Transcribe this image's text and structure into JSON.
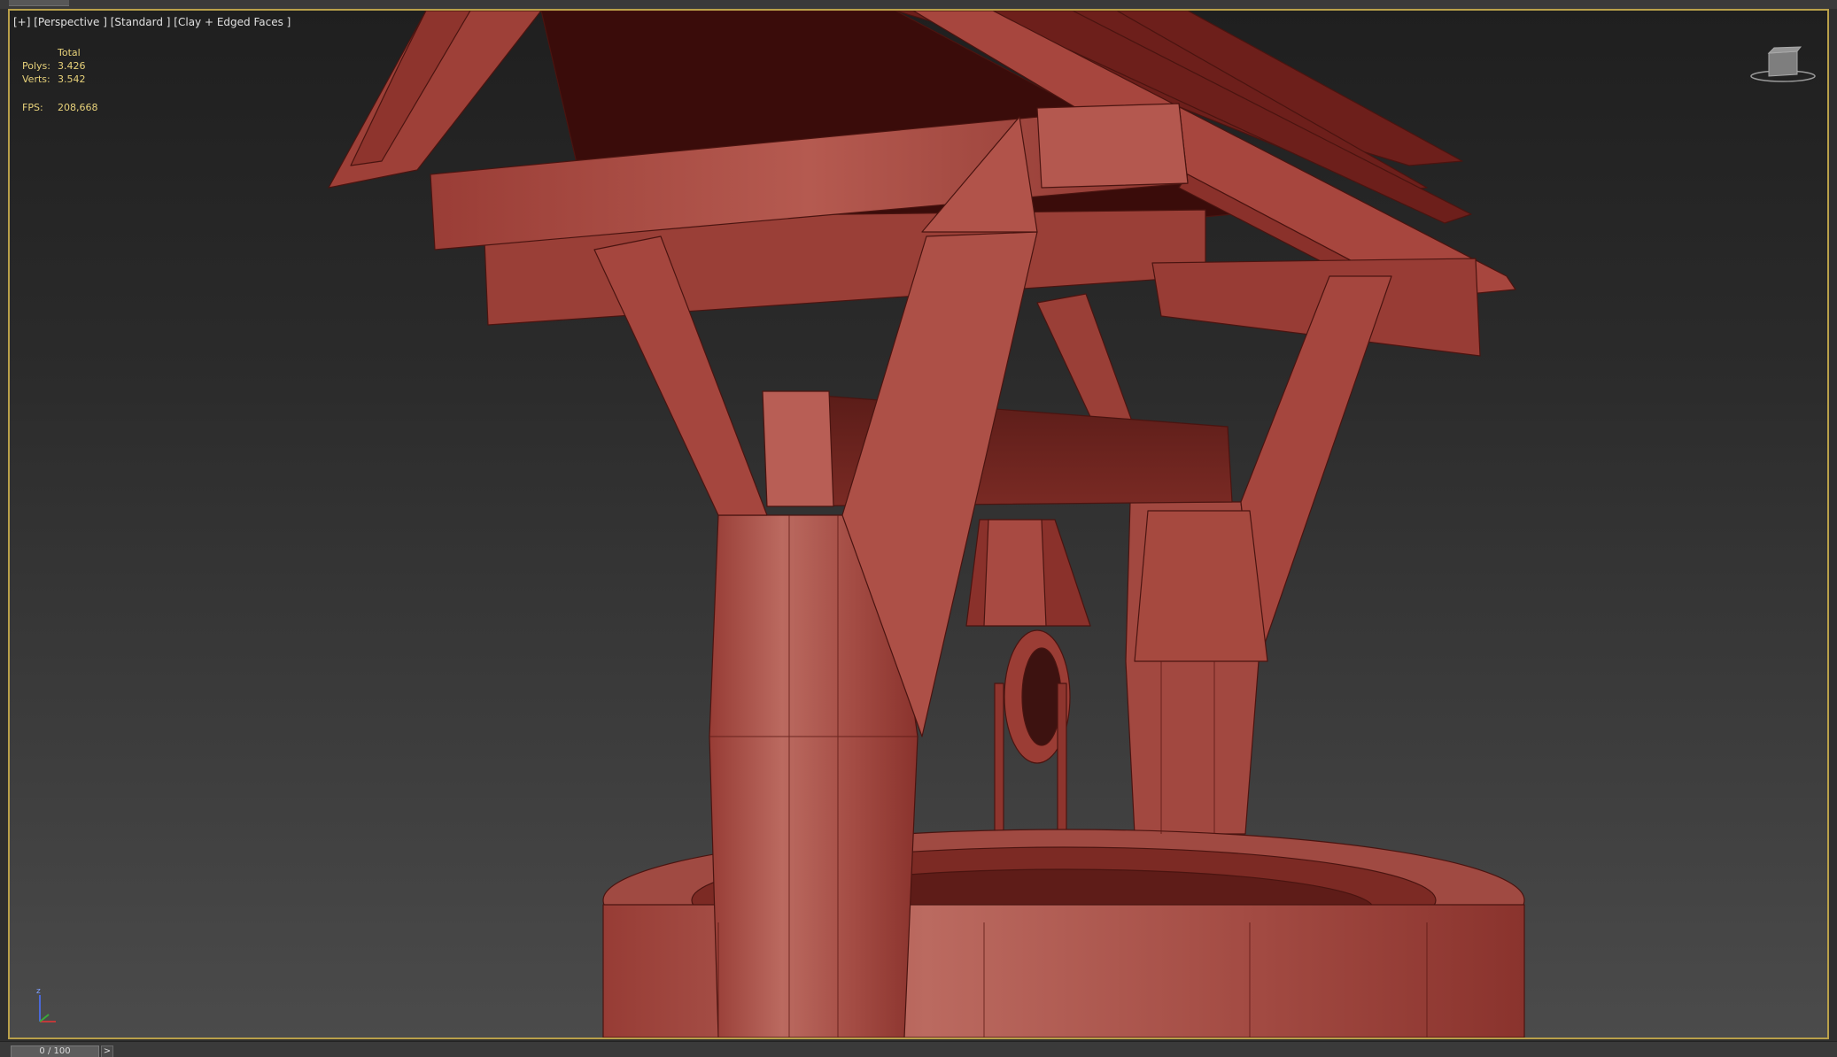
{
  "viewport": {
    "label": "[+] [Perspective ] [Standard ] [Clay + Edged Faces ]",
    "active_border_color": "#b9a04a",
    "model_color": "#a8483f"
  },
  "stats": {
    "header": "Total",
    "polys_label": "Polys:",
    "polys_value": "3.426",
    "verts_label": "Verts:",
    "verts_value": "3.542",
    "fps_label": "FPS:",
    "fps_value": "208,668",
    "text_color": "#e8d27a"
  },
  "viewcube": {
    "icon": "viewcube-icon"
  },
  "axis": {
    "icon": "axis-tripod-icon",
    "z_label": "z"
  },
  "timeslider": {
    "position_text": "0 / 100",
    "next_label": ">"
  }
}
